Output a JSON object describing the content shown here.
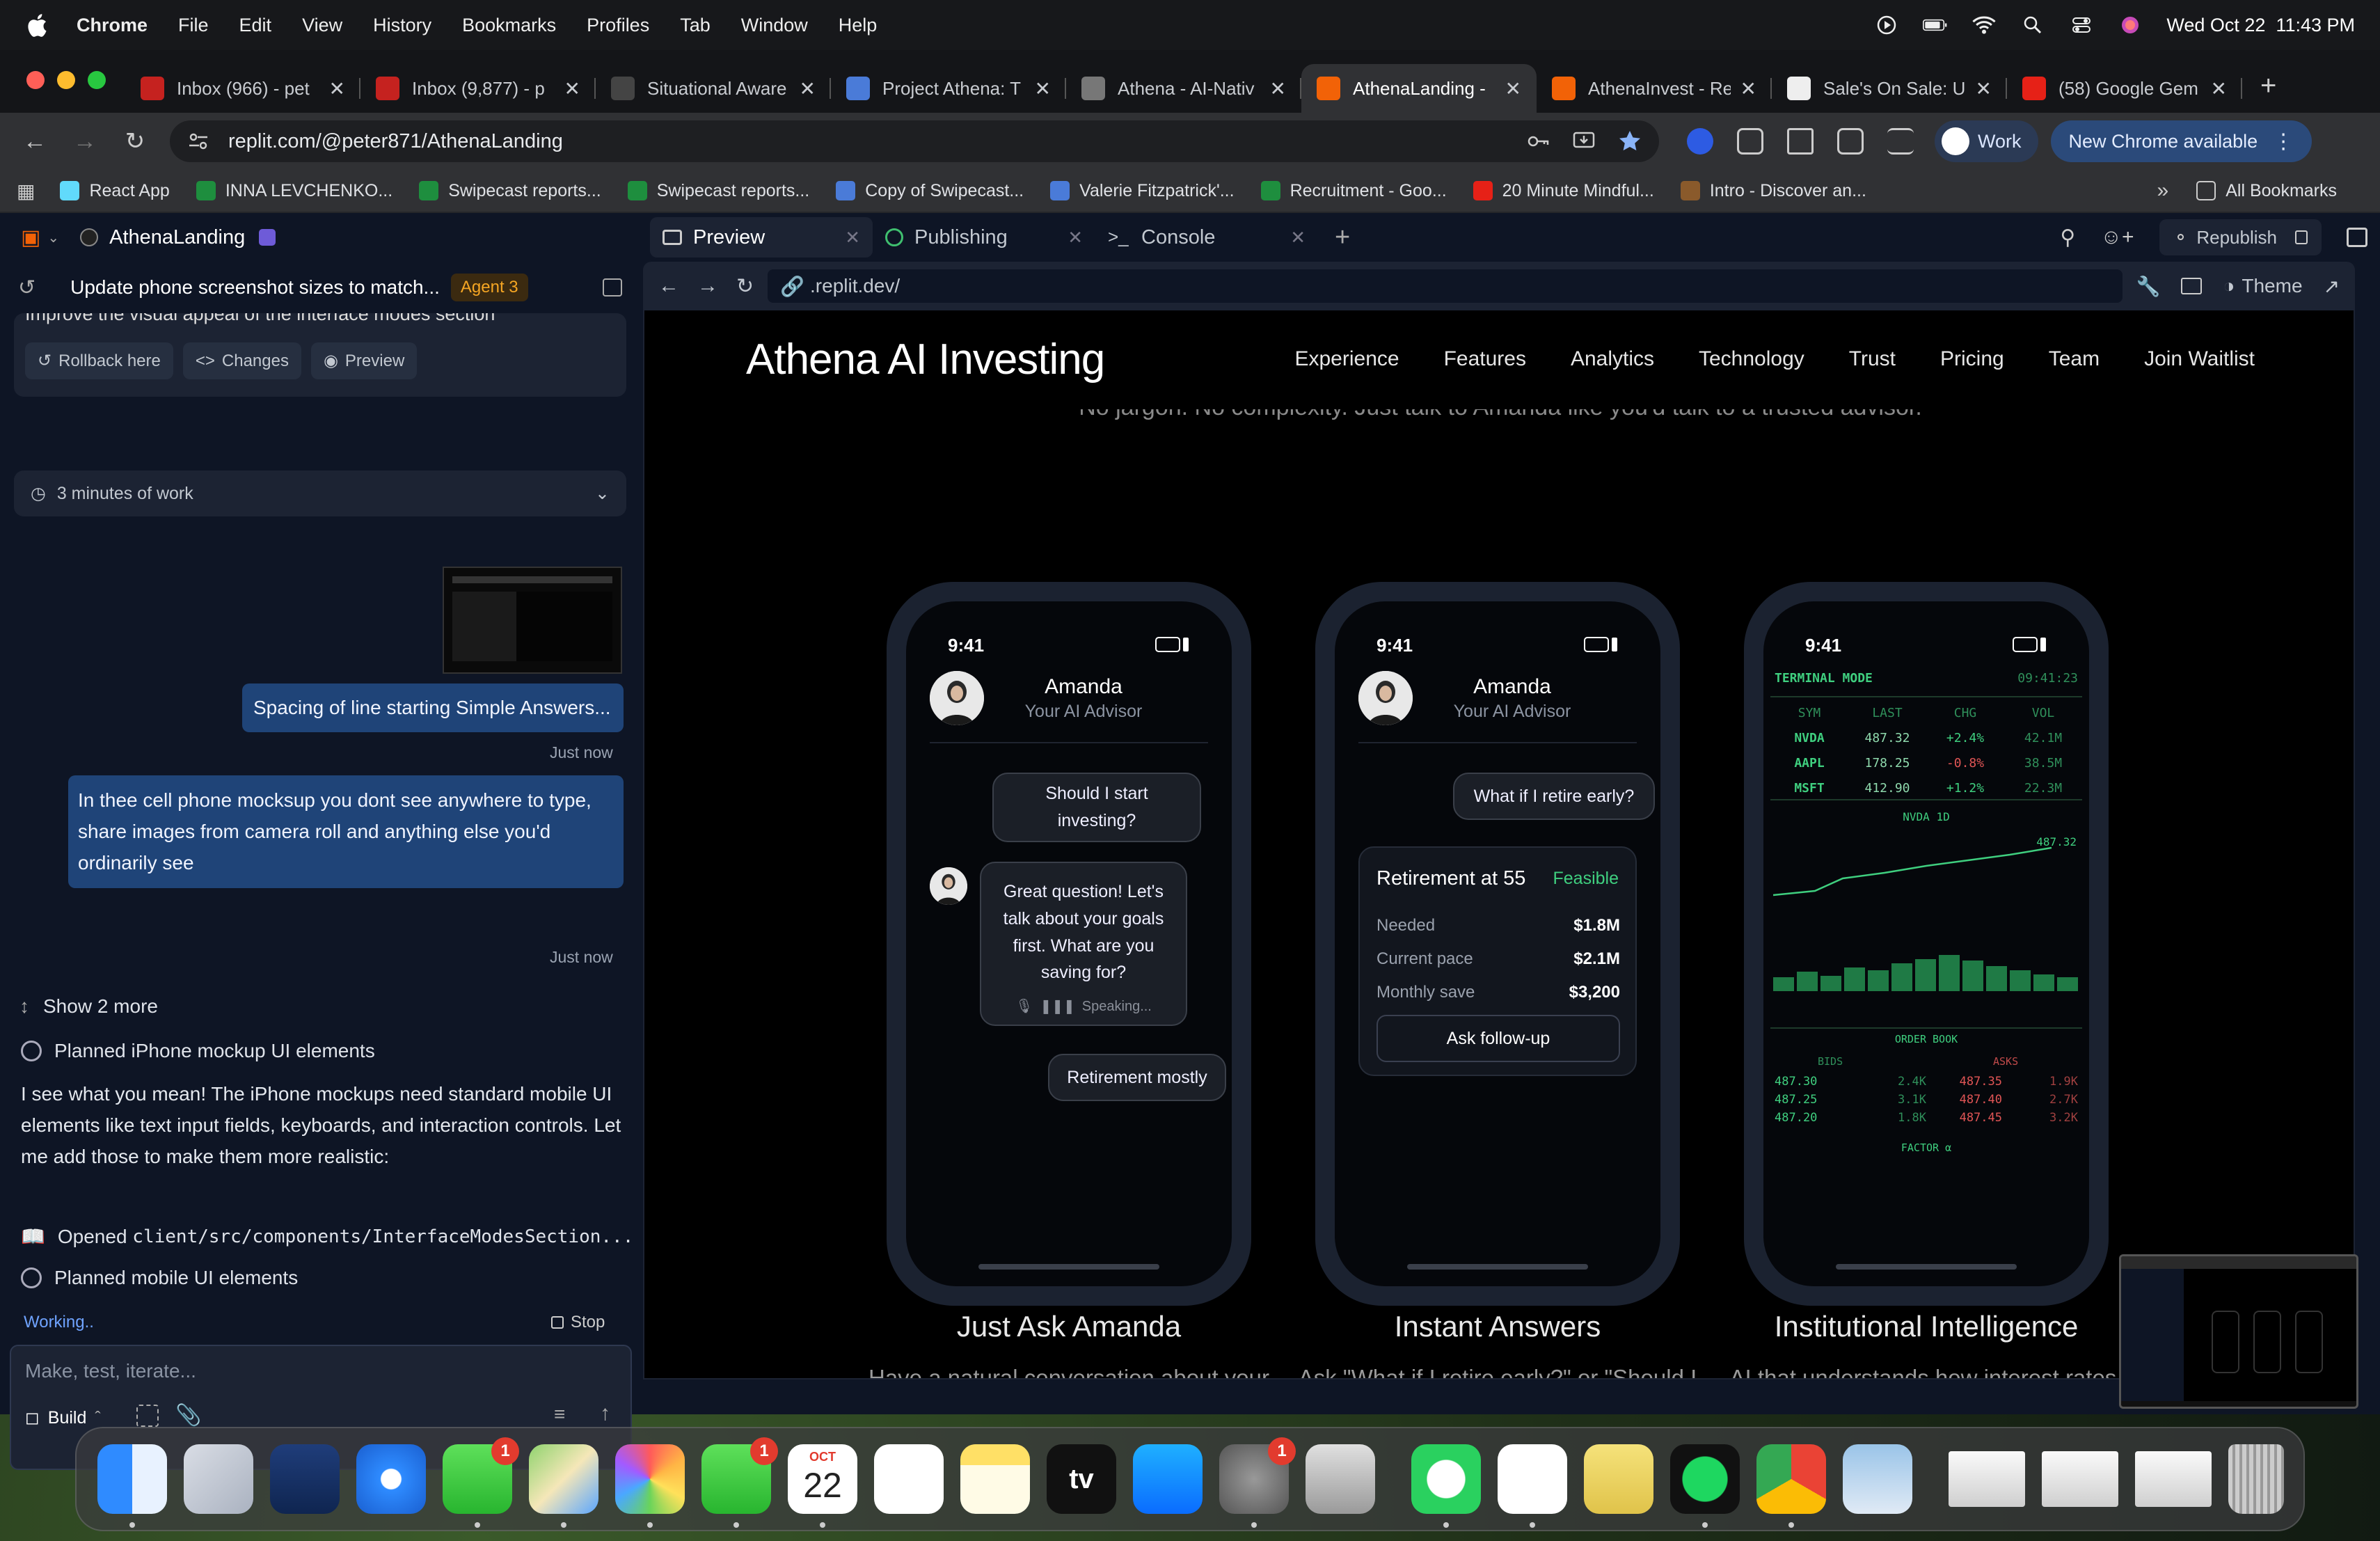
{
  "menubar": {
    "app": "Chrome",
    "items": [
      "File",
      "Edit",
      "View",
      "History",
      "Bookmarks",
      "Profiles",
      "Tab",
      "Window",
      "Help"
    ],
    "datetime": "Wed Oct 22  11:43 PM"
  },
  "tabs": [
    {
      "title": "Inbox (966) - pet",
      "color": "#c5221f"
    },
    {
      "title": "Inbox (9,877) - p",
      "color": "#c5221f"
    },
    {
      "title": "Situational Aware",
      "color": "#444"
    },
    {
      "title": "Project Athena: T",
      "color": "#4a7bd8"
    },
    {
      "title": "Athena - AI-Nativ",
      "color": "#777"
    },
    {
      "title": "AthenaLanding -",
      "color": "#f26207",
      "active": true
    },
    {
      "title": "AthenaInvest - Re",
      "color": "#f26207"
    },
    {
      "title": "Sale's On Sale: U",
      "color": "#eee"
    },
    {
      "title": "(58) Google Gem",
      "color": "#e62117"
    }
  ],
  "address": "replit.com/@peter871/AthenaLanding",
  "profile_label": "Work",
  "update_label": "New Chrome available",
  "bookmarks": [
    {
      "label": "React App",
      "color": "#61dafb"
    },
    {
      "label": "INNA LEVCHENKO...",
      "color": "#1e8e3e"
    },
    {
      "label": "Swipecast reports...",
      "color": "#1e8e3e"
    },
    {
      "label": "Swipecast reports...",
      "color": "#1e8e3e"
    },
    {
      "label": "Copy of Swipecast...",
      "color": "#4a7bd8"
    },
    {
      "label": "Valerie Fitzpatrick'...",
      "color": "#4a7bd8"
    },
    {
      "label": "Recruitment - Goo...",
      "color": "#1e8e3e"
    },
    {
      "label": "20 Minute Mindful...",
      "color": "#e62117"
    },
    {
      "label": "Intro - Discover an...",
      "color": "#8a5a2b"
    }
  ],
  "all_bookmarks": "All Bookmarks",
  "replit": {
    "project": "AthenaLanding",
    "thread_title": "Update phone screenshot sizes to match...",
    "agent_badge": "Agent 3",
    "prev_text": "Improve the visual appeal of the interface modes section",
    "rollback": "Rollback here",
    "changes": "Changes",
    "preview": "Preview",
    "work_time": "3 minutes of work",
    "msg1": "Spacing of line starting Simple Answers...",
    "msg1_time": "Just now",
    "msg2": "In thee cell phone mocksup you dont see anywhere to type, share images from camera roll and anything else you'd ordinarily see",
    "msg2_time": "Just now",
    "show_more": "Show 2 more",
    "planned1": "Planned iPhone mockup UI elements",
    "agent_reply": "I see what you mean! The iPhone mockups need standard mobile UI elements like text input fields, keyboards, and interaction controls. Let me add those to make them more realistic:",
    "opened_prefix": "Opened ",
    "opened_path": "client/src/components/InterfaceModesSection...",
    "planned2": "Planned mobile UI elements",
    "working": "Working..",
    "stop": "Stop",
    "input_placeholder": "Make, test, iterate...",
    "build": "Build"
  },
  "workspace": {
    "tab_preview": "Preview",
    "tab_publishing": "Publishing",
    "tab_console": "Console",
    "republish": "Republish",
    "url": ".replit.dev/",
    "theme": "Theme"
  },
  "site": {
    "brand": "Athena AI Investing",
    "nav": [
      "Experience",
      "Features",
      "Analytics",
      "Technology",
      "Trust",
      "Pricing",
      "Team",
      "Join Waitlist"
    ],
    "tagline": "No jargon. No complexity. Just talk to Amanda like you'd talk to a trusted advisor.",
    "phone_time": "9:41",
    "advisor_name": "Amanda",
    "advisor_role": "Your AI Advisor",
    "p1": {
      "q1": "Should I start investing?",
      "a1": "Great question! Let's talk about your goals first. What are you saving for?",
      "speaking": "Speaking...",
      "q2": "Retirement mostly"
    },
    "p2": {
      "q1": "What if I retire early?",
      "card_title": "Retirement at 55",
      "card_status": "Feasible",
      "rows": [
        {
          "label": "Needed",
          "value": "$1.8M"
        },
        {
          "label": "Current pace",
          "value": "$2.1M"
        },
        {
          "label": "Monthly save",
          "value": "$3,200"
        }
      ],
      "cta": "Ask follow-up"
    },
    "p3": {
      "mode": "TERMINAL MODE",
      "clock": "09:41:23",
      "headers": [
        "SYM",
        "LAST",
        "CHG",
        "VOL"
      ],
      "rows": [
        {
          "sym": "NVDA",
          "last": "487.32",
          "chg": "+2.4%",
          "vol": "42.1M"
        },
        {
          "sym": "AAPL",
          "last": "178.25",
          "chg": "-0.8%",
          "vol": "38.5M"
        },
        {
          "sym": "MSFT",
          "last": "412.90",
          "chg": "+1.2%",
          "vol": "22.3M"
        }
      ],
      "chart_label": "NVDA 1D",
      "chart_price": "487.32",
      "orderbook": "ORDER BOOK",
      "bids_label": "BIDS",
      "asks_label": "ASKS",
      "book": [
        {
          "bid": "487.30",
          "bsz": "2.4K",
          "ask": "487.35",
          "asz": "1.9K"
        },
        {
          "bid": "487.25",
          "bsz": "3.1K",
          "ask": "487.40",
          "asz": "2.7K"
        },
        {
          "bid": "487.20",
          "bsz": "1.8K",
          "ask": "487.45",
          "asz": "3.2K"
        }
      ],
      "factor": "FACTOR α"
    },
    "features": [
      {
        "title": "Just Ask Amanda",
        "desc": "Have a natural conversation about your goals. Amanda"
      },
      {
        "title": "Instant Answers",
        "desc": "Ask \"What if I retire early?\" or \"Should I buy now?\" Get clear"
      },
      {
        "title": "Institutional Intelligence",
        "desc": "AI that understands how interest rates, earnings, and"
      }
    ]
  },
  "dock": {
    "apps": [
      "finder",
      "launchpad",
      "direct-mail",
      "safari",
      "messages",
      "maps",
      "photos",
      "facetime",
      "calendar",
      "reminders",
      "notes",
      "apple-tv",
      "app-store",
      "system-settings",
      "iphone-mirroring",
      "whatsapp",
      "slack",
      "stickies",
      "spotify",
      "chrome",
      "preview"
    ],
    "badges": {
      "messages": "1",
      "facetime": "1",
      "system-settings": "1"
    },
    "calendar_month": "OCT",
    "calendar_day": "22",
    "tv_label": "tv"
  }
}
